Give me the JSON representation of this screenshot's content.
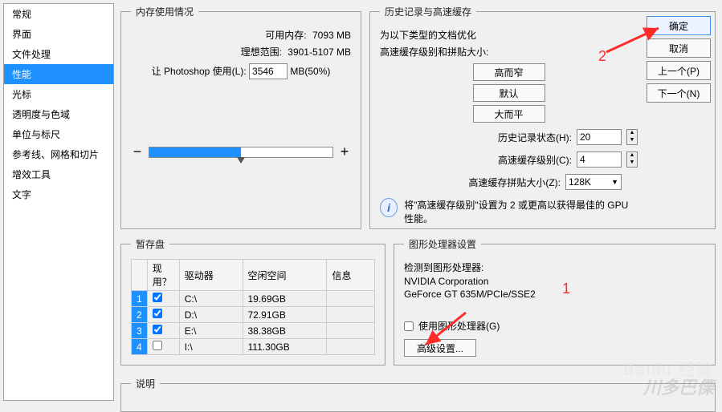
{
  "sidebar": {
    "items": [
      {
        "label": "常规"
      },
      {
        "label": "界面"
      },
      {
        "label": "文件处理"
      },
      {
        "label": "性能"
      },
      {
        "label": "光标"
      },
      {
        "label": "透明度与色域"
      },
      {
        "label": "单位与标尺"
      },
      {
        "label": "参考线、网格和切片"
      },
      {
        "label": "增效工具"
      },
      {
        "label": "文字"
      }
    ],
    "selected_index": 3
  },
  "memory": {
    "legend": "内存使用情况",
    "available_label": "可用内存:",
    "available_value": "7093 MB",
    "ideal_label": "理想范围:",
    "ideal_value": "3901-5107 MB",
    "let_use_label": "让 Photoshop 使用(L):",
    "let_use_value": "3546",
    "let_use_suffix": "MB(50%)",
    "slider_percent": 50,
    "minus": "−",
    "plus": "+"
  },
  "history": {
    "legend": "历史记录与高速缓存",
    "note1": "为以下类型的文档优化",
    "note2": "高速缓存级别和拼贴大小:",
    "btn_tall": "高而窄",
    "btn_default": "默认",
    "btn_wide": "大而平",
    "states_label": "历史记录状态(H):",
    "states_value": "20",
    "cache_levels_label": "高速缓存级别(C):",
    "cache_levels_value": "4",
    "tile_size_label": "高速缓存拼贴大小(Z):",
    "tile_size_value": "128K",
    "info_text": "将\"高速缓存级别\"设置为 2 或更高以获得最佳的 GPU 性能。"
  },
  "scratch": {
    "legend": "暂存盘",
    "headers": {
      "active": "现用？",
      "drive": "驱动器",
      "free": "空闲空间",
      "info": "信息"
    },
    "rows": [
      {
        "n": "1",
        "checked": true,
        "drive": "C:\\",
        "free": "19.69GB",
        "info": ""
      },
      {
        "n": "2",
        "checked": true,
        "drive": "D:\\",
        "free": "72.91GB",
        "info": ""
      },
      {
        "n": "3",
        "checked": true,
        "drive": "E:\\",
        "free": "38.38GB",
        "info": ""
      },
      {
        "n": "4",
        "checked": false,
        "drive": "I:\\",
        "free": "111.30GB",
        "info": ""
      }
    ]
  },
  "gpu": {
    "legend": "图形处理器设置",
    "detected_label": "检测到图形处理器:",
    "vendor": "NVIDIA Corporation",
    "model": "GeForce GT 635M/PCIe/SSE2",
    "use_gpu_label": "使用图形处理器(G)",
    "use_gpu_checked": false,
    "advanced_btn": "高级设置..."
  },
  "desc": {
    "legend": "说明"
  },
  "buttons": {
    "ok": "确定",
    "cancel": "取消",
    "prev": "上一个(P)",
    "next": "下一个(N)"
  },
  "annotations": {
    "num1": "1",
    "num2": "2"
  },
  "watermark": {
    "brand": "Baidu 经验",
    "site": "川多巴傈"
  }
}
